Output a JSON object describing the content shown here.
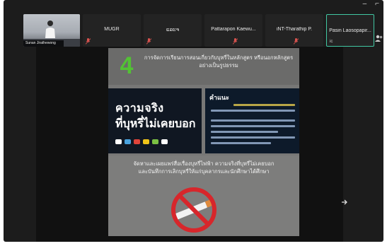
{
  "window": {
    "controls": [
      "–",
      "⌐"
    ]
  },
  "participants": [
    {
      "name": "Sunan Jirathewong",
      "type": "video"
    },
    {
      "name": "MUGR",
      "type": "avatar",
      "muted": true
    },
    {
      "name": "ແລະຈ",
      "type": "avatar",
      "muted": true
    },
    {
      "name": "Pattarapon Kaewu...",
      "type": "avatar",
      "muted": true
    },
    {
      "name": "iNT-Tharathip P.",
      "type": "avatar",
      "muted": true
    },
    {
      "name": "Pasin Laosopapir...",
      "sub": "ic",
      "type": "avatar",
      "active": true
    }
  ],
  "slide": {
    "number": "4",
    "heading": "การจัดการเรียนการสอนเกี่ยวกับบุหรี่ในหลักสูตร หรือนอกหลักสูตรอย่างเป็นรูปธรรม",
    "image_left": {
      "line1": "ความจริง",
      "line2": "ที่บุหรี่ไม่เคยบอก"
    },
    "image_right": {
      "title": "คำแนะ"
    },
    "body": "จัดหาและเผยแพร่สื่อเรื่องบุหรี่ไฟฟ้า ความจริงที่บุหรี่ไม่เคยบอก และบันทึกการเลิกบุหรี่ให้แก่บุคลากรและนักศึกษาได้ศึกษา"
  },
  "colors": {
    "active_border": "#41c7a3",
    "mic_muted": "#d9534f",
    "number_green": "#52c234",
    "no_smoking_red": "#d7262b"
  }
}
